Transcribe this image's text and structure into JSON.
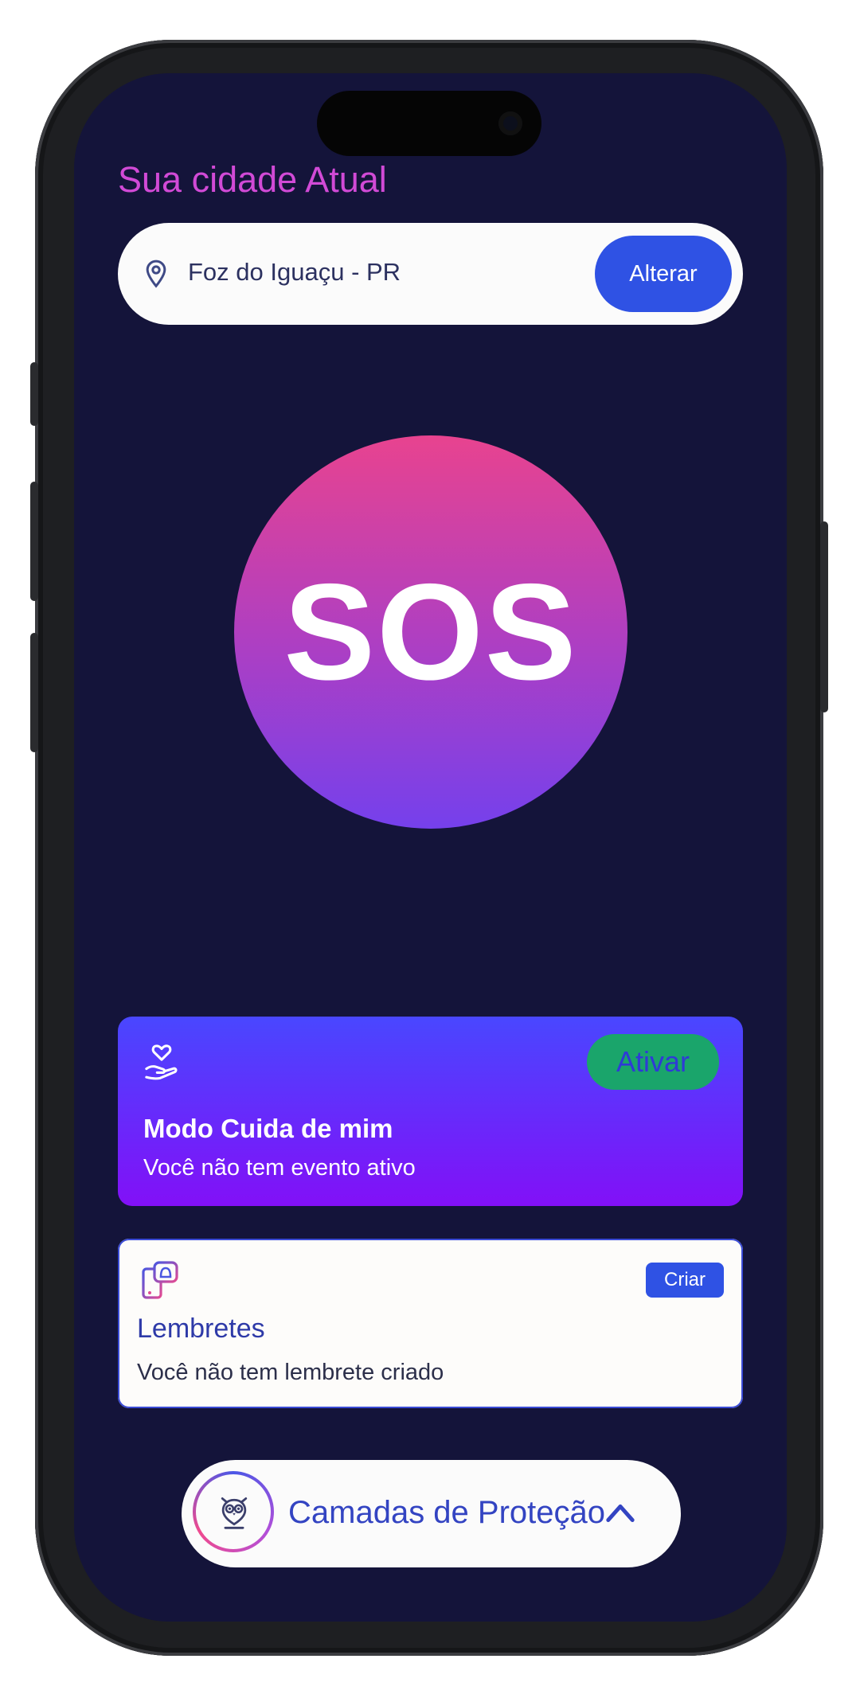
{
  "header": {
    "title": "Sua cidade Atual"
  },
  "location": {
    "city": "Foz do Iguaçu - PR",
    "change_label": "Alterar"
  },
  "sos": {
    "label": "SOS"
  },
  "care_mode": {
    "title": "Modo Cuida de mim",
    "subtitle": "Você não tem evento ativo",
    "action_label": "Ativar"
  },
  "reminders": {
    "title": "Lembretes",
    "subtitle": "Você não tem lembrete criado",
    "action_label": "Criar"
  },
  "protection": {
    "label": "Camadas de Proteção"
  },
  "icons": {
    "location": "map-pin-icon",
    "care": "heart-hand-icon",
    "reminder": "phone-bell-icon",
    "owl": "owl-pin-icon",
    "expand": "chevron-up-icon"
  },
  "colors": {
    "background": "#14143a",
    "accent_blue": "#2f52e4",
    "title_magenta": "#d14ad6",
    "activate_green": "#1aa56b",
    "sos_top": "#e8438f",
    "sos_bottom": "#7540ec"
  }
}
